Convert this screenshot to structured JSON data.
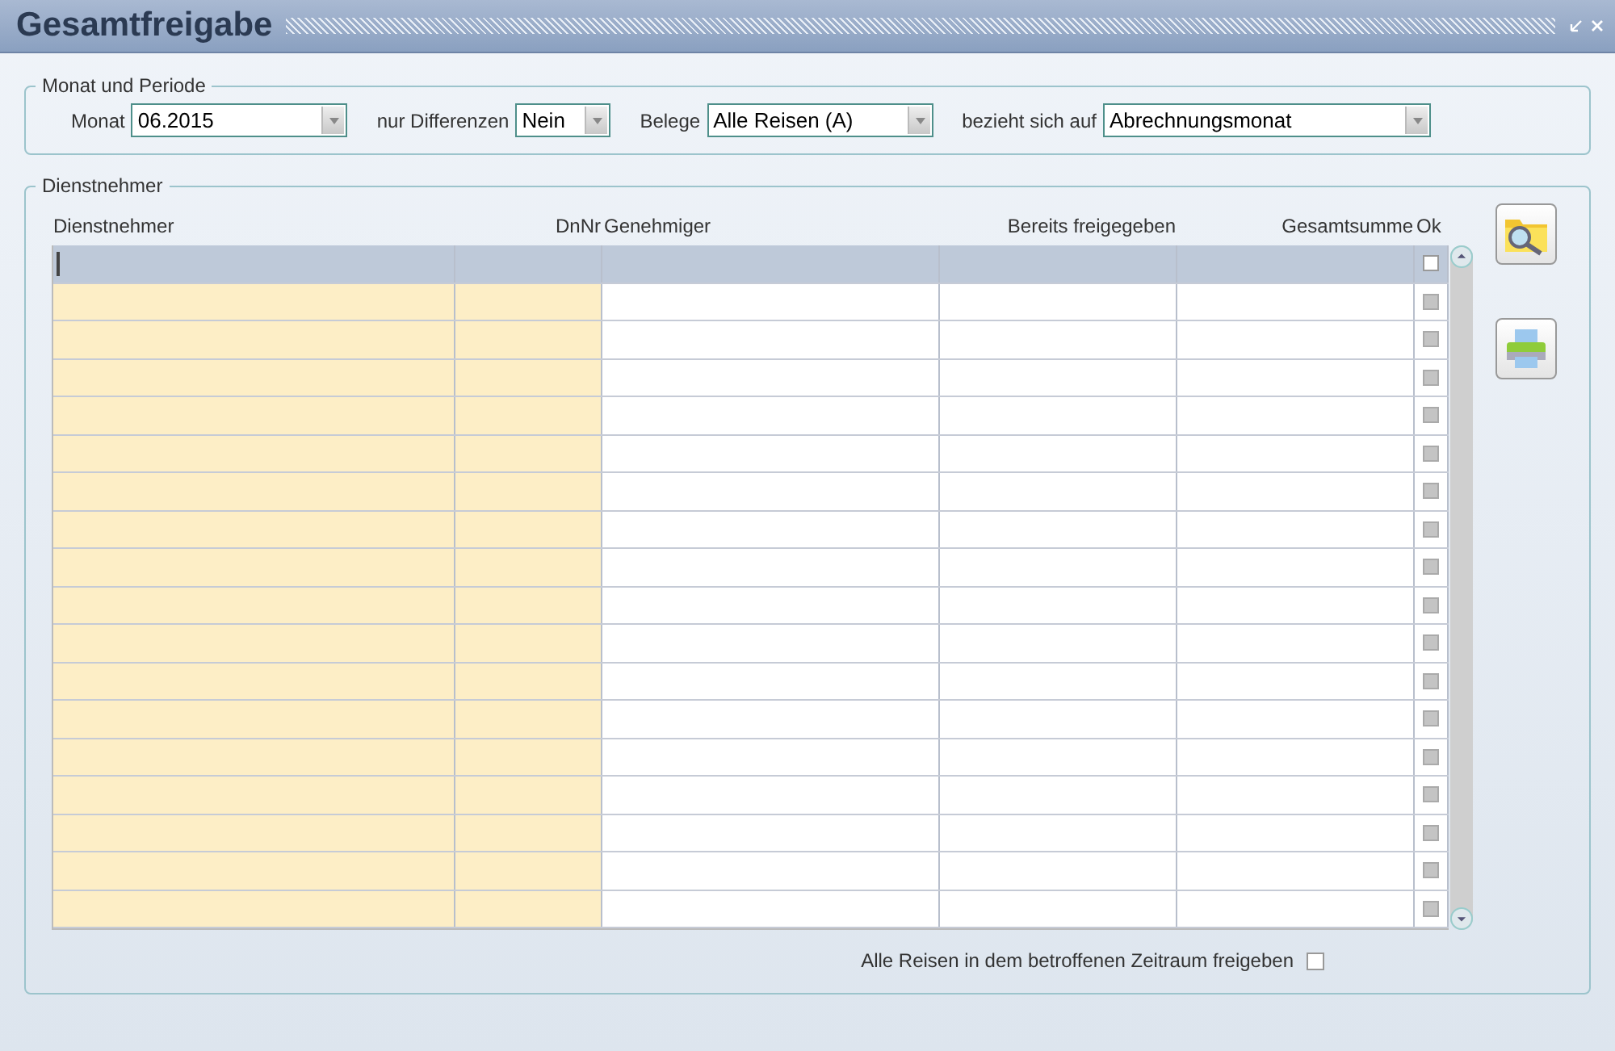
{
  "window": {
    "title": "Gesamtfreigabe"
  },
  "period_group": {
    "legend": "Monat und Periode",
    "filters": [
      {
        "label": "Monat",
        "value": "06.2015"
      },
      {
        "label": "nur Differenzen",
        "value": "Nein"
      },
      {
        "label": "Belege",
        "value": "Alle Reisen (A)"
      },
      {
        "label": "bezieht sich auf",
        "value": "Abrechnungsmonat"
      }
    ]
  },
  "employee_group": {
    "legend": "Dienstnehmer",
    "table": {
      "columns": [
        {
          "label": "Dienstnehmer"
        },
        {
          "label": "DnNr"
        },
        {
          "label": "Genehmiger"
        },
        {
          "label": "Bereits freigegeben"
        },
        {
          "label": "Gesamtsumme"
        },
        {
          "label": "Ok"
        }
      ],
      "rows": [
        {
          "selected": true,
          "ok_checked": false,
          "ok_disabled": false
        },
        {
          "selected": false,
          "ok_checked": false,
          "ok_disabled": true
        },
        {
          "selected": false,
          "ok_checked": false,
          "ok_disabled": true
        },
        {
          "selected": false,
          "ok_checked": false,
          "ok_disabled": true
        },
        {
          "selected": false,
          "ok_checked": false,
          "ok_disabled": true
        },
        {
          "selected": false,
          "ok_checked": false,
          "ok_disabled": true
        },
        {
          "selected": false,
          "ok_checked": false,
          "ok_disabled": true
        },
        {
          "selected": false,
          "ok_checked": false,
          "ok_disabled": true
        },
        {
          "selected": false,
          "ok_checked": false,
          "ok_disabled": true
        },
        {
          "selected": false,
          "ok_checked": false,
          "ok_disabled": true
        },
        {
          "selected": false,
          "ok_checked": false,
          "ok_disabled": true
        },
        {
          "selected": false,
          "ok_checked": false,
          "ok_disabled": true
        },
        {
          "selected": false,
          "ok_checked": false,
          "ok_disabled": true
        },
        {
          "selected": false,
          "ok_checked": false,
          "ok_disabled": true
        },
        {
          "selected": false,
          "ok_checked": false,
          "ok_disabled": true
        },
        {
          "selected": false,
          "ok_checked": false,
          "ok_disabled": true
        },
        {
          "selected": false,
          "ok_checked": false,
          "ok_disabled": true
        },
        {
          "selected": false,
          "ok_checked": false,
          "ok_disabled": true
        }
      ]
    },
    "release_all": {
      "label": "Alle Reisen in dem betroffenen Zeitraum freigeben",
      "checked": false
    }
  }
}
